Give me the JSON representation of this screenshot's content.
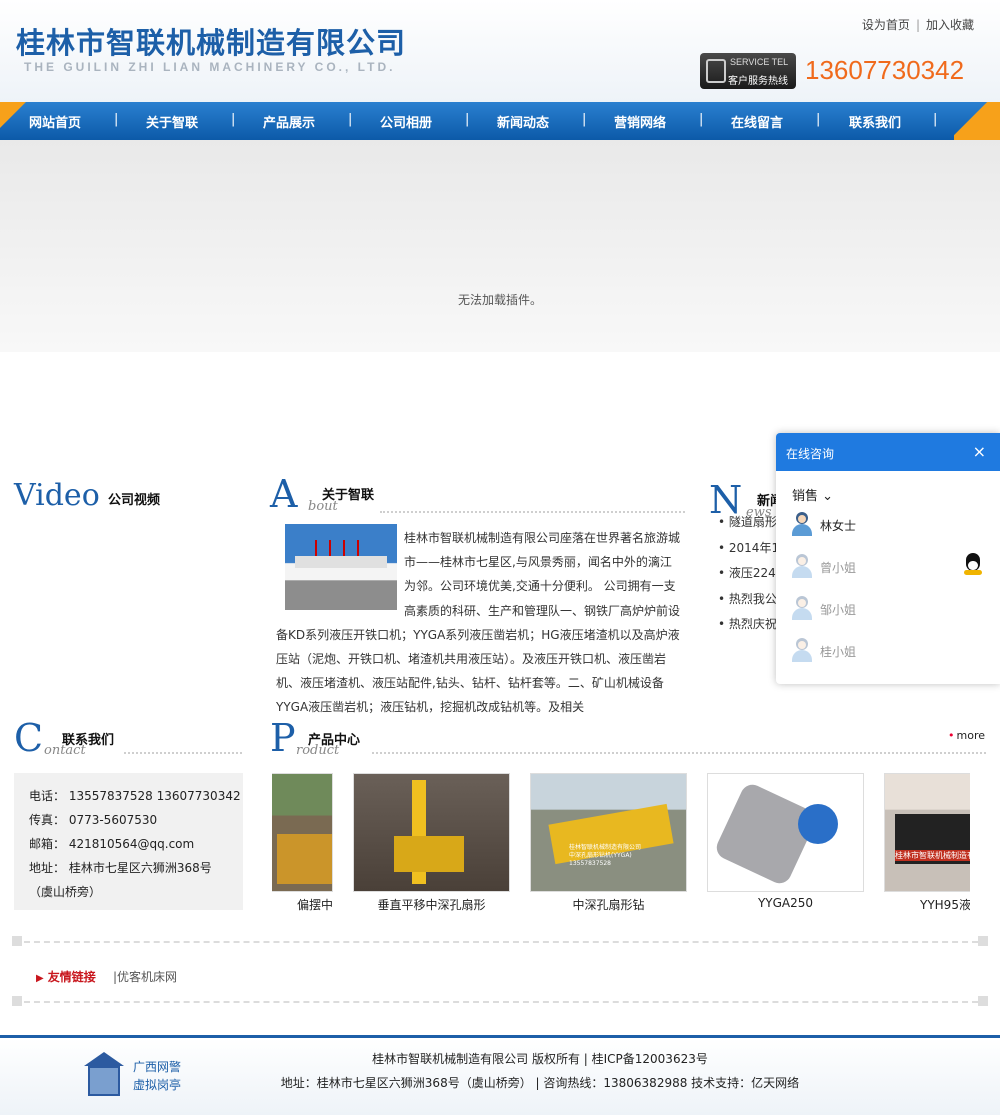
{
  "header": {
    "logo_cn": "桂林市智联机械制造有限公司",
    "logo_en": "THE GUILIN ZHI LIAN MACHINERY CO., LTD.",
    "links": [
      "设为首页",
      "加入收藏"
    ],
    "service_badge": {
      "line1": "SERVICE TEL",
      "line2": "客户服务热线"
    },
    "tel": "13607730342"
  },
  "nav": {
    "items": [
      "网站首页",
      "关于智联",
      "产品展示",
      "公司相册",
      "新闻动态",
      "营销网络",
      "在线留言",
      "联系我们"
    ],
    "separator": "|"
  },
  "banner": {
    "message": "无法加载插件。"
  },
  "video": {
    "title_en": "Video",
    "title_cn": "公司视频"
  },
  "about": {
    "letter": "A",
    "sub_word": "bout",
    "title": "关于智联",
    "text": "桂林市智联机械制造有限公司座落在世界著名旅游城市——桂林市七星区,与风景秀丽，闻名中外的漓江为邻。公司环境优美,交通十分便利。 公司拥有一支高素质的科研、生产和管理队一、钢铁厂高炉炉前设备KD系列液压开铁口机；YYGA系列液压凿岩机；HG液压堵渣机以及高炉液压站（泥炮、开铁口机、堵渣机共用液压站）。及液压开铁口机、液压凿岩机、液压堵渣机、液压站配件,钻头、钻杆、钻杆套等。二、矿山机械设备YYGA液压凿岩机；液压钻机，挖掘机改成钻机等。及相关"
  },
  "news": {
    "letter": "N",
    "sub_word": "ews",
    "title": "新闻",
    "items": [
      "隧道扇形",
      "2014年12",
      "液压2245",
      "热烈我公",
      "热烈庆祝"
    ]
  },
  "contact": {
    "letter": "C",
    "sub_word": "ontact",
    "title": "联系我们",
    "lines": [
      "电话： 13557837528   13607730342",
      "传真： 0773-5607530",
      "邮箱： 421810564@qq.com",
      "地址： 桂林市七星区六狮洲368号",
      "（虞山桥旁）"
    ]
  },
  "products": {
    "letter": "P",
    "sub_word": "roduct",
    "title": "产品中心",
    "more": "more",
    "items": [
      {
        "caption": "偏摆中",
        "bg": "#7a6a52",
        "accent": "#e0a020"
      },
      {
        "caption": "垂直平移中深孔扇形",
        "bg": "#4a4038",
        "accent": "#f0c020"
      },
      {
        "caption": "中深孔扇形钻",
        "bg": "#8a8f80",
        "accent": "#e8b820",
        "overlay_text": [
          "桂林智联机械制造有限公司",
          "中深孔扇形钻机(YYGA)",
          "13557837528"
        ]
      },
      {
        "caption": "YYGA250",
        "bg": "#d9d9dc",
        "accent": "#2a6fc8"
      },
      {
        "caption": "YYH95液",
        "bg": "#c8c0b8",
        "accent": "#c03020",
        "overlay_text": [
          "桂林市智联机械制造有限公司"
        ]
      }
    ]
  },
  "links": {
    "label": "友情链接",
    "items": [
      "优客机床网"
    ]
  },
  "footer": {
    "police": [
      "广西网警",
      "虚拟岗亭"
    ],
    "line1": "桂林市智联机械制造有限公司 版权所有 | 桂ICP备12003623号",
    "line2": "地址：桂林市七星区六狮洲368号（虞山桥旁） | 咨询热线：13806382988 技术支持：亿天网络"
  },
  "chat": {
    "title": "在线咨询",
    "close": "×",
    "group": "销售 ⌄",
    "agents": [
      {
        "name": "林女士",
        "online": true
      },
      {
        "name": "曾小姐",
        "online": false
      },
      {
        "name": "邹小姐",
        "online": false
      },
      {
        "name": "桂小姐",
        "online": false
      }
    ]
  }
}
